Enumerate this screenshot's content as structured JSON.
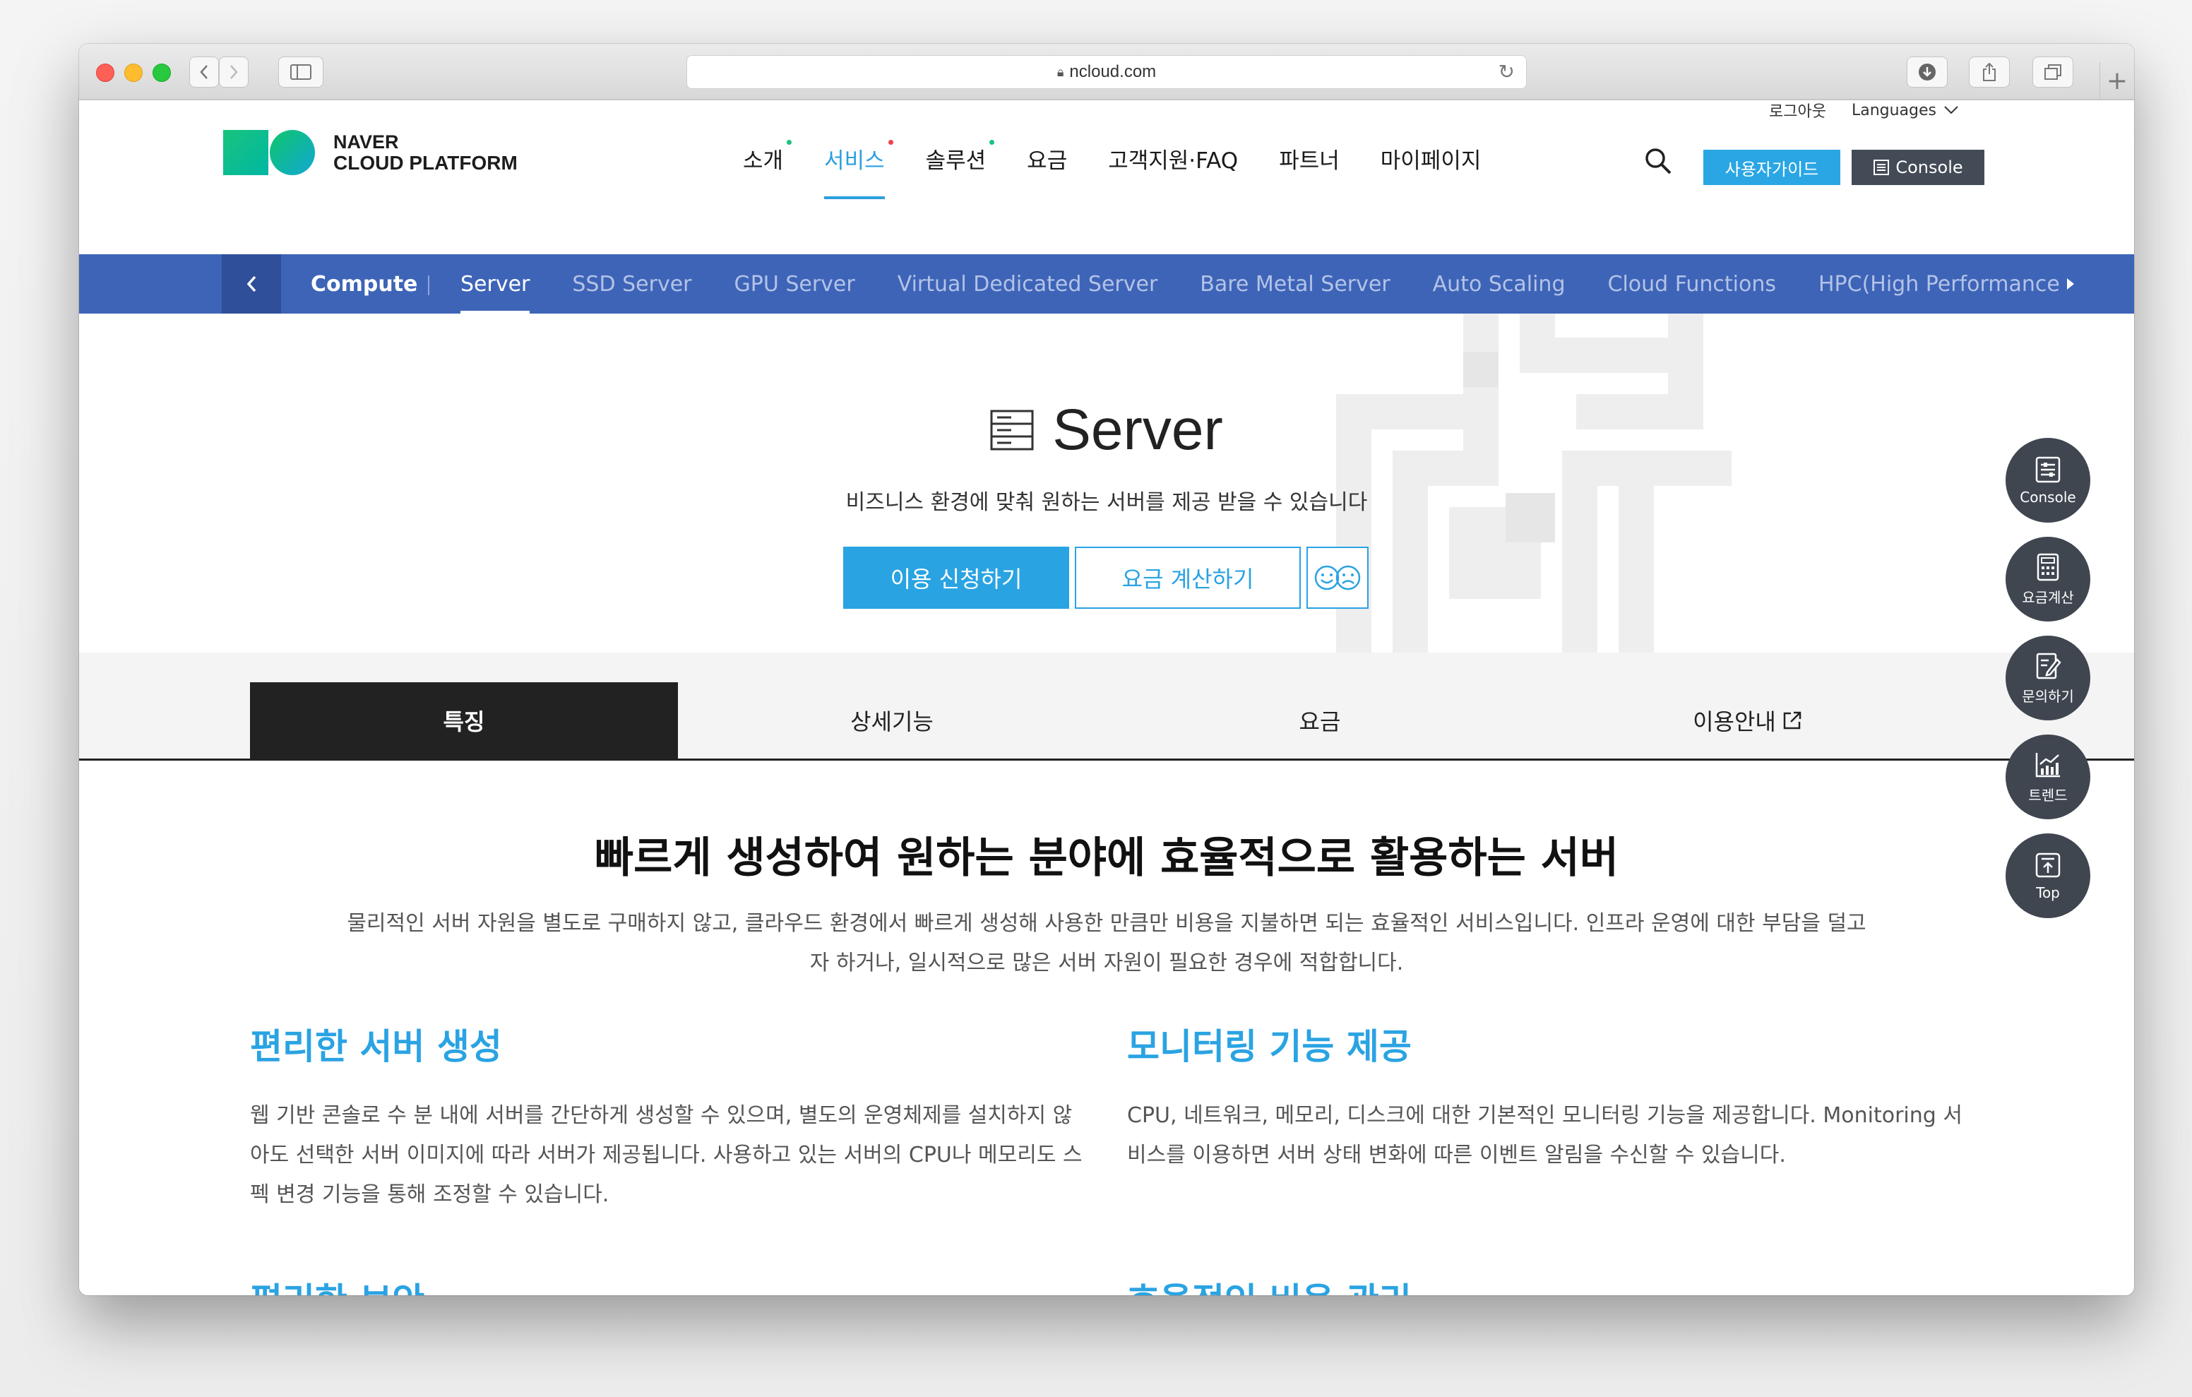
{
  "browser": {
    "url": "ncloud.com"
  },
  "header": {
    "logo_line1": "NAVER",
    "logo_line2": "CLOUD PLATFORM",
    "utility": {
      "logout": "로그아웃",
      "languages": "Languages"
    },
    "nav": [
      {
        "label": "소개",
        "dot_color": "#19c37d"
      },
      {
        "label": "서비스",
        "dot_color": "#f0414a",
        "active": true
      },
      {
        "label": "솔루션",
        "dot_color": "#19c37d"
      },
      {
        "label": "요금"
      },
      {
        "label": "고객지원·FAQ"
      },
      {
        "label": "파트너"
      },
      {
        "label": "마이페이지"
      }
    ],
    "guide_button": "사용자가이드",
    "console_button": "Console"
  },
  "subnav": {
    "category": "Compute",
    "items": [
      {
        "label": "Server",
        "active": true
      },
      {
        "label": "SSD Server"
      },
      {
        "label": "GPU Server"
      },
      {
        "label": "Virtual Dedicated Server"
      },
      {
        "label": "Bare Metal Server"
      },
      {
        "label": "Auto Scaling"
      },
      {
        "label": "Cloud Functions"
      },
      {
        "label": "HPC(High Performance"
      }
    ]
  },
  "hero": {
    "title": "Server",
    "subtitle": "비즈니스 환경에 맞춰 원하는 서버를 제공 받을 수 있습니다",
    "apply_button": "이용 신청하기",
    "calc_button": "요금 계산하기"
  },
  "tabs": [
    {
      "label": "특징",
      "active": true
    },
    {
      "label": "상세기능"
    },
    {
      "label": "요금"
    },
    {
      "label": "이용안내"
    }
  ],
  "content": {
    "title": "빠르게 생성하여 원하는 분야에 효율적으로 활용하는 서버",
    "desc_line1": "물리적인 서버 자원을 별도로 구매하지 않고, 클라우드 환경에서 빠르게 생성해 사용한 만큼만 비용을 지불하면 되는 효율적인 서비스입니다. 인프라 운영에 대한 부담을 덜고",
    "desc_line2": "자 하거나, 일시적으로 많은 서버 자원이 필요한 경우에 적합합니다.",
    "features": [
      {
        "title": "편리한 서버 생성",
        "lines": [
          "웹 기반 콘솔로 수 분 내에 서버를 간단하게 생성할 수 있으며, 별도의 운영체제를 설치하지 않",
          "아도 선택한 서버 이미지에 따라 서버가 제공됩니다. 사용하고 있는 서버의 CPU나 메모리도 스",
          "펙 변경 기능을 통해 조정할 수 있습니다."
        ]
      },
      {
        "title": "모니터링 기능 제공",
        "lines": [
          "CPU, 네트워크, 메모리, 디스크에 대한 기본적인 모니터링 기능을 제공합니다. Monitoring 서",
          "비스를 이용하면 서버 상태 변화에 따른 이벤트 알림을 수신할 수 있습니다."
        ]
      }
    ],
    "next_left": "편리한 보안",
    "next_right": "효율적인 비용 관리"
  },
  "quick_menu": [
    {
      "label": "Console",
      "icon": "console-icon"
    },
    {
      "label": "요금계산",
      "icon": "calculator-icon"
    },
    {
      "label": "문의하기",
      "icon": "inquiry-icon"
    },
    {
      "label": "트렌드",
      "icon": "trend-chart-icon"
    },
    {
      "label": "Top",
      "icon": "arrow-up-icon"
    }
  ]
}
